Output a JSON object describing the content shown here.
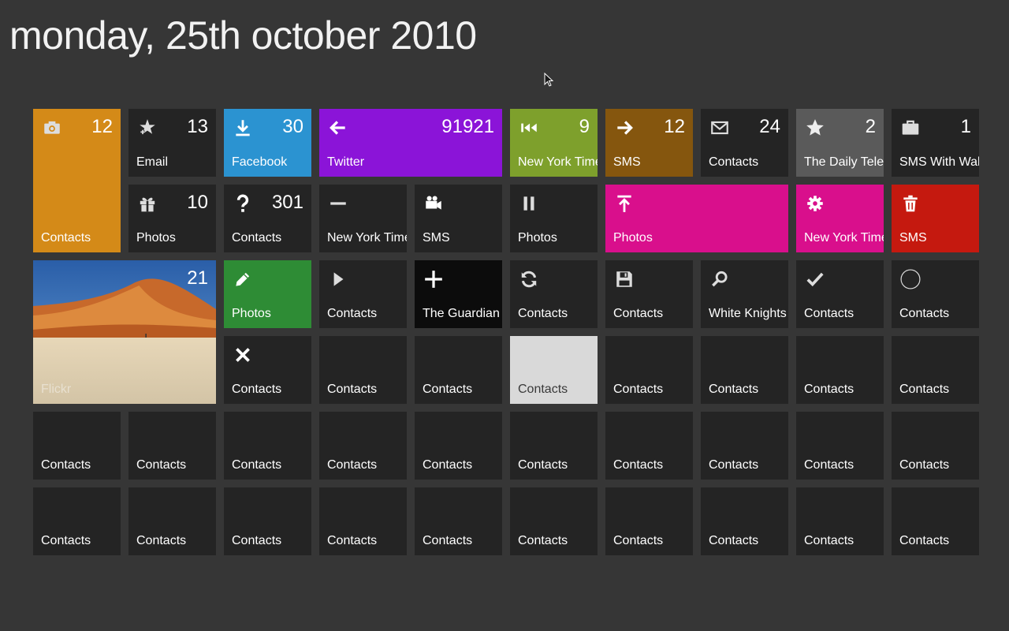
{
  "page": {
    "title": "monday, 25th october 2010",
    "background": "#363636"
  },
  "tiles": [
    {
      "id": "t1",
      "label": "Contacts",
      "count": "12",
      "icon": "camera-icon",
      "color": "#d48a18"
    },
    {
      "id": "t2",
      "label": "Email",
      "count": "13",
      "icon": "sparkle-star-icon",
      "color": "#242424"
    },
    {
      "id": "t3",
      "label": "Facebook",
      "count": "30",
      "icon": "download-icon",
      "color": "#2b93d1"
    },
    {
      "id": "t4",
      "label": "Twitter",
      "count": "91921",
      "icon": "arrow-left-icon",
      "color": "#8b14d8"
    },
    {
      "id": "t5",
      "label": "New York Times",
      "count": "9",
      "icon": "skip-back-icon",
      "color": "#7ea02c"
    },
    {
      "id": "t6",
      "label": "SMS",
      "count": "12",
      "icon": "arrow-right-icon",
      "color": "#85560e"
    },
    {
      "id": "t7",
      "label": "Contacts",
      "count": "24",
      "icon": "envelope-icon",
      "color": "#242424"
    },
    {
      "id": "t8",
      "label": "The Daily Telegraph",
      "count": "2",
      "icon": "star-icon",
      "color": "#5a5a5a"
    },
    {
      "id": "t9",
      "label": "SMS With Walter",
      "count": "1",
      "icon": "briefcase-icon",
      "color": "#242424"
    },
    {
      "id": "t10",
      "label": "Photos",
      "count": "10",
      "icon": "gift-icon",
      "color": "#242424"
    },
    {
      "id": "t11",
      "label": "Contacts",
      "count": "301",
      "icon": "question-icon",
      "color": "#242424"
    },
    {
      "id": "t12",
      "label": "New York Times",
      "count": "",
      "icon": "minus-icon",
      "color": "#242424"
    },
    {
      "id": "t13",
      "label": "SMS",
      "count": "",
      "icon": "video-camera-icon",
      "color": "#242424"
    },
    {
      "id": "t14",
      "label": "Photos",
      "count": "",
      "icon": "pause-icon",
      "color": "#242424"
    },
    {
      "id": "t15",
      "label": "Photos",
      "count": "",
      "icon": "upload-top-icon",
      "color": "#d90f8c"
    },
    {
      "id": "t16",
      "label": "New York Times",
      "count": "",
      "icon": "gear-icon",
      "color": "#d90f8c"
    },
    {
      "id": "t17",
      "label": "SMS",
      "count": "",
      "icon": "trash-icon",
      "color": "#c5190f"
    },
    {
      "id": "t18",
      "label": "Flickr",
      "count": "21",
      "icon": "",
      "color": "#d9c7a3"
    },
    {
      "id": "t19",
      "label": "Photos",
      "count": "",
      "icon": "pencil-icon",
      "color": "#2e8c35"
    },
    {
      "id": "t20",
      "label": "Contacts",
      "count": "",
      "icon": "play-icon",
      "color": "#242424"
    },
    {
      "id": "t21",
      "label": "The Guardian",
      "count": "",
      "icon": "plus-icon",
      "color": "#0c0c0c"
    },
    {
      "id": "t22",
      "label": "Contacts",
      "count": "",
      "icon": "refresh-icon",
      "color": "#242424"
    },
    {
      "id": "t23",
      "label": "Contacts",
      "count": "",
      "icon": "save-icon",
      "color": "#242424"
    },
    {
      "id": "t24",
      "label": "White Knights",
      "count": "",
      "icon": "search-icon",
      "color": "#242424"
    },
    {
      "id": "t25",
      "label": "Contacts",
      "count": "",
      "icon": "check-icon",
      "color": "#242424"
    },
    {
      "id": "t26",
      "label": "Contacts",
      "count": "",
      "icon": "circle-icon",
      "color": "#242424"
    },
    {
      "id": "t27",
      "label": "Contacts",
      "count": "",
      "icon": "close-icon",
      "color": "#242424"
    },
    {
      "id": "t28",
      "label": "Contacts",
      "count": "",
      "icon": "",
      "color": "#242424"
    },
    {
      "id": "t29",
      "label": "Contacts",
      "count": "",
      "icon": "",
      "color": "#242424"
    },
    {
      "id": "t30",
      "label": "Contacts",
      "count": "",
      "icon": "",
      "color": "#d9d9d9"
    },
    {
      "id": "t31",
      "label": "Contacts",
      "count": "",
      "icon": "",
      "color": "#242424"
    },
    {
      "id": "t32",
      "label": "Contacts",
      "count": "",
      "icon": "",
      "color": "#242424"
    },
    {
      "id": "t33",
      "label": "Contacts",
      "count": "",
      "icon": "",
      "color": "#242424"
    },
    {
      "id": "t34",
      "label": "Contacts",
      "count": "",
      "icon": "",
      "color": "#242424"
    },
    {
      "id": "t35",
      "label": "Contacts",
      "count": "",
      "icon": "",
      "color": "#242424"
    },
    {
      "id": "t36",
      "label": "Contacts",
      "count": "",
      "icon": "",
      "color": "#242424"
    },
    {
      "id": "t37",
      "label": "Contacts",
      "count": "",
      "icon": "",
      "color": "#242424"
    },
    {
      "id": "t38",
      "label": "Contacts",
      "count": "",
      "icon": "",
      "color": "#242424"
    },
    {
      "id": "t39",
      "label": "Contacts",
      "count": "",
      "icon": "",
      "color": "#242424"
    },
    {
      "id": "t40",
      "label": "Contacts",
      "count": "",
      "icon": "",
      "color": "#242424"
    },
    {
      "id": "t41",
      "label": "Contacts",
      "count": "",
      "icon": "",
      "color": "#242424"
    },
    {
      "id": "t42",
      "label": "Contacts",
      "count": "",
      "icon": "",
      "color": "#242424"
    },
    {
      "id": "t43",
      "label": "Contacts",
      "count": "",
      "icon": "",
      "color": "#242424"
    },
    {
      "id": "t44",
      "label": "Contacts",
      "count": "",
      "icon": "",
      "color": "#242424"
    },
    {
      "id": "t45",
      "label": "Contacts",
      "count": "",
      "icon": "",
      "color": "#242424"
    },
    {
      "id": "t46",
      "label": "Contacts",
      "count": "",
      "icon": "",
      "color": "#242424"
    },
    {
      "id": "t47",
      "label": "Contacts",
      "count": "",
      "icon": "",
      "color": "#242424"
    },
    {
      "id": "t48",
      "label": "Contacts",
      "count": "",
      "icon": "",
      "color": "#242424"
    },
    {
      "id": "t49",
      "label": "Contacts",
      "count": "",
      "icon": "",
      "color": "#242424"
    },
    {
      "id": "t50",
      "label": "Contacts",
      "count": "",
      "icon": "",
      "color": "#242424"
    },
    {
      "id": "t51",
      "label": "Contacts",
      "count": "",
      "icon": "",
      "color": "#242424"
    },
    {
      "id": "t52",
      "label": "Contacts",
      "count": "",
      "icon": "",
      "color": "#242424"
    },
    {
      "id": "t53",
      "label": "Contacts",
      "count": "",
      "icon": "",
      "color": "#242424"
    },
    {
      "id": "t54",
      "label": "Contacts",
      "count": "",
      "icon": "",
      "color": "#242424"
    },
    {
      "id": "t55",
      "label": "Contacts",
      "count": "",
      "icon": "",
      "color": "#242424"
    },
    {
      "id": "t56",
      "label": "Contacts",
      "count": "",
      "icon": "",
      "color": "#242424"
    }
  ]
}
